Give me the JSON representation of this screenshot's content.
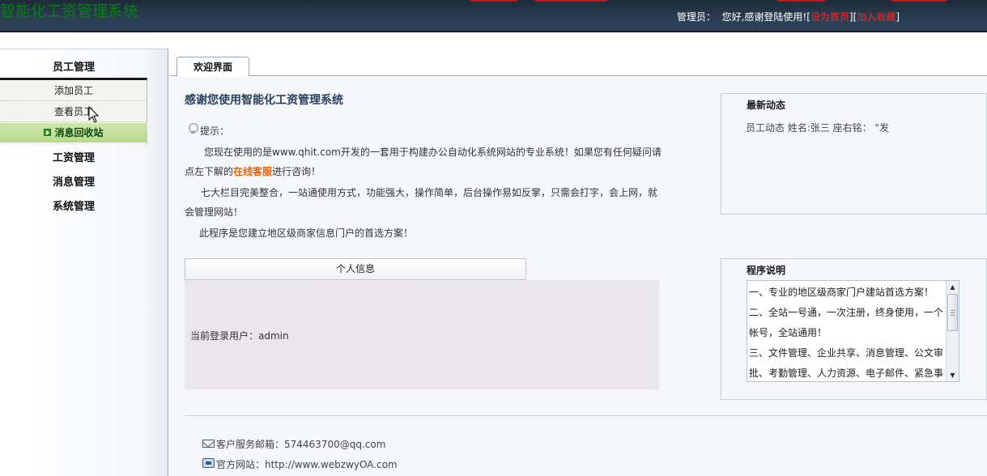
{
  "header": {
    "app_title": "智能化工资管理系统",
    "role_label": "管理员：",
    "greeting": "您好,感谢登陆使用!",
    "bracket_open_1": "[",
    "set_home": "设为首页",
    "bracket_close_1": "]",
    "bracket_open_2": "[",
    "add_favorite": "加入收藏",
    "bracket_close_2": "]"
  },
  "sidebar": {
    "employee_mgmt": "员工管理",
    "add_employee": "添加员工",
    "view_employee": "查看员工",
    "recycle_bin": "消息回收站",
    "salary_mgmt": "工资管理",
    "message_mgmt": "消息管理",
    "system_mgmt": "系统管理"
  },
  "tabs": {
    "welcome": "欢迎界面"
  },
  "main": {
    "thanks_title": "感谢您使用智能化工资管理系统",
    "hint_label": "提示：",
    "para1_a": "您现在使用的是www.qhit.com开发的一套用于构建办公自动化系统网站的专业系统！如果您有任何疑问请点左下解的",
    "para1_link": "在线客服",
    "para1_b": "进行咨询！",
    "para2": "七大栏目完美整合，一站通使用方式，功能强大，操作简单，后台操作易如反掌，只需会打字，会上网，就会管理网站！",
    "para3": "此程序是您建立地区级商家信息门户的首选方案！",
    "personal_info_title": "个人信息",
    "current_user": "当前登录用户：admin"
  },
  "news": {
    "title": "最新动态",
    "item": "员工动态  姓名:张三    座右铭：  \"发"
  },
  "program": {
    "title": "程序说明",
    "lines": [
      "一、专业的地区级商家门户建站首选方案！",
      "二、全站一号通，一次注册，终身使用，一个帐号，全站通用！",
      "三、文件管理、企业共享、消息管理、公文审批、考勤管理、人力资源、电子邮件、紧急事"
    ]
  },
  "footer": {
    "email_label": "客户服务邮箱：574463700@qq.com",
    "site_label": "官方网站：http://www.webzwyOA.com"
  },
  "icons": [
    "bulb-icon",
    "mail-icon",
    "phone-icon",
    "arrow-right-icon",
    "mouse-cursor-icon",
    "scroll-up-icon",
    "scroll-down-icon"
  ]
}
